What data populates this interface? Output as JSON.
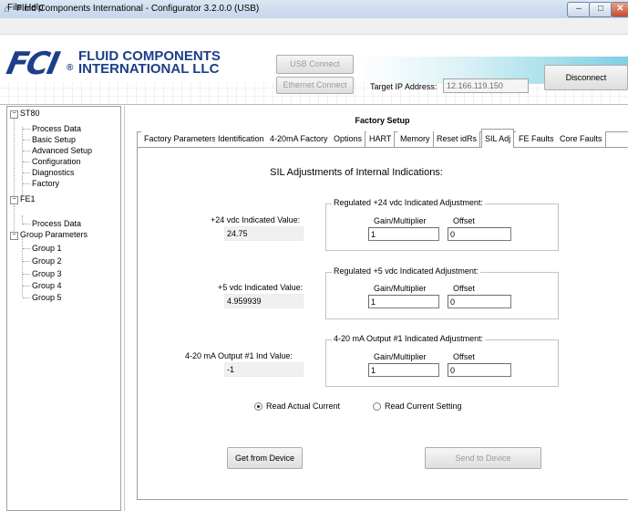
{
  "window": {
    "title": "Fluid Components International - Configurator 3.2.0.0 (USB)",
    "icon": "fci-app-icon"
  },
  "menu": {
    "file": "File",
    "help": "Help"
  },
  "header": {
    "logo_mark": "FCI",
    "logo_reg": "®",
    "logo_line1": "FLUID COMPONENTS",
    "logo_line2": "INTERNATIONAL LLC",
    "usb_connect": "USB Connect",
    "ethernet_connect": "Ethernet Connect",
    "ip_label": "Target IP Address:",
    "ip_value": "12.166.119.150",
    "disconnect": "Disconnect"
  },
  "tree": {
    "nodes": [
      {
        "label": "ST80",
        "expander": "⊟"
      },
      {
        "label": "Process Data"
      },
      {
        "label": "Basic Setup"
      },
      {
        "label": "Advanced Setup"
      },
      {
        "label": "Configuration"
      },
      {
        "label": "Diagnostics"
      },
      {
        "label": "Factory"
      },
      {
        "label": "FE1",
        "expander": "⊟"
      },
      {
        "label": "Process Data"
      },
      {
        "label": "Group Parameters",
        "expander": "⊟"
      },
      {
        "label": "Group 1"
      },
      {
        "label": "Group 2"
      },
      {
        "label": "Group 3"
      },
      {
        "label": "Group 4"
      },
      {
        "label": "Group 5"
      }
    ]
  },
  "panel": {
    "title": "Factory Setup",
    "tabs": [
      "Factory Parameters",
      "Identification",
      "4-20mA Factory",
      "Options",
      "HART",
      "Memory",
      "Reset idRs",
      "SIL Adj",
      "FE Faults",
      "Core Faults"
    ],
    "active_tab": "SIL Adj",
    "heading": "SIL Adjustments of Internal Indications:",
    "rows": [
      {
        "value_label": "+24 vdc Indicated Value:",
        "value": "24.75",
        "group_title": "Regulated +24 vdc Indicated Adjustment:",
        "gain_label": "Gain/Multiplier",
        "gain": "1",
        "offset_label": "Offset",
        "offset": "0"
      },
      {
        "value_label": "+5 vdc Indicated Value:",
        "value": "4.959939",
        "group_title": "Regulated +5 vdc Indicated Adjustment:",
        "gain_label": "Gain/Multiplier",
        "gain": "1",
        "offset_label": "Offset",
        "offset": "0"
      },
      {
        "value_label": "4-20 mA Output #1 Ind Value:",
        "value": "-1",
        "group_title": "4-20 mA Output #1 Indicated Adjustment:",
        "gain_label": "Gain/Multiplier",
        "gain": "1",
        "offset_label": "Offset",
        "offset": "0"
      }
    ],
    "radio_actual": "Read Actual Current",
    "radio_setting": "Read Current Setting",
    "radio_selected": "Read Actual Current",
    "get_button": "Get from Device",
    "send_button": "Send to Device"
  },
  "colors": {
    "brand": "#1b3f8a",
    "titlebar": "#c5d6ea",
    "accent_wave": "#7fd0e4"
  }
}
